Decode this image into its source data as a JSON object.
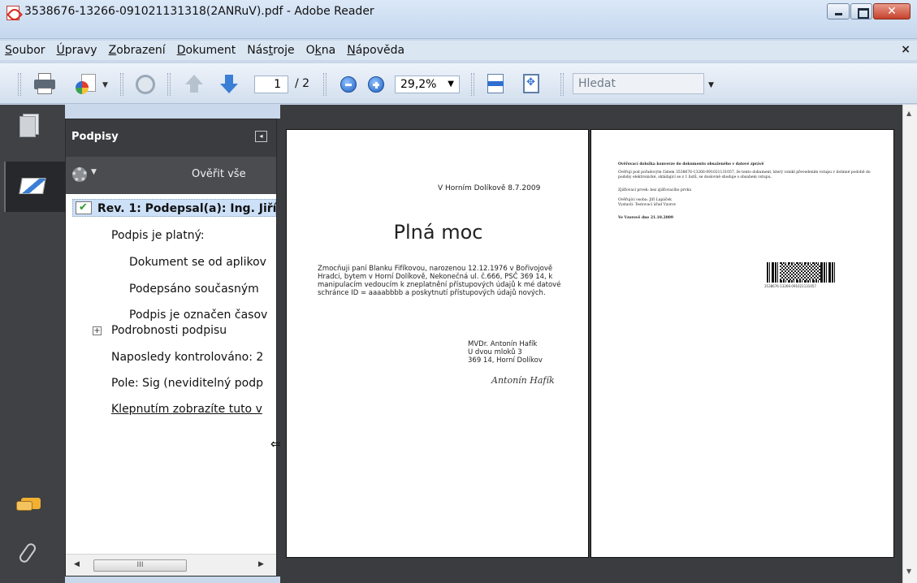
{
  "window": {
    "title": "3538676-13266-091021131318(2ANRuV).pdf - Adobe Reader"
  },
  "menu": [
    {
      "pre": "",
      "ul": "S",
      "post": "oubor"
    },
    {
      "pre": "",
      "ul": "Ú",
      "post": "pravy"
    },
    {
      "pre": "",
      "ul": "Z",
      "post": "obrazení"
    },
    {
      "pre": "",
      "ul": "D",
      "post": "okument"
    },
    {
      "pre": "Nás",
      "ul": "t",
      "post": "roje"
    },
    {
      "pre": "O",
      "ul": "k",
      "post": "na"
    },
    {
      "pre": "",
      "ul": "N",
      "post": "ápověda"
    }
  ],
  "menu_close": "×",
  "toolbar": {
    "page_current": "1",
    "page_total": "/ 2",
    "zoom": "29,2%",
    "search_placeholder": "Hledat"
  },
  "panel": {
    "title": "Podpisy",
    "collapse_glyph": "◂",
    "verify_all": "Ověřit vše",
    "rows": [
      "Rev. 1: Podepsal(a): Ing. Jiří",
      "Podpis je platný:",
      "Dokument se od aplikov",
      "Podepsáno současným",
      "Podpis je označen časov",
      "Podrobnosti podpisu",
      "Naposledy kontrolováno: 2",
      "Pole: Sig (neviditelný podp",
      "Klepnutím zobrazíte tuto v"
    ],
    "expander": "+",
    "hscroll_thumb": "III"
  },
  "page1": {
    "date": "V Horním Dolíkově 8.7.2009",
    "heading": "Plná moc",
    "body": "Zmocňuji paní Blanku Fifíkovou, narozenou 12.12.1976 v Bořivojově Hradci, bytem v Horní Dolíkově, Nekonečná ul. č.666, PSČ 369 14, k manipulacím vedoucím k zneplatnění přístupových údajů k mé datové schránce ID = aaaabbbb a poskytnutí přístupových údajů nových.",
    "addr_name": "MVDr. Antonín Hafík",
    "addr_street": "U dvou mloků 3",
    "addr_city": "369 14, Horní Dolíkov",
    "signature": "Antonín Hafík"
  },
  "page2": {
    "heading": "Ověřovací doložka konverze do dokumentu obsaženého v datové zprávě",
    "para": "Ověřuji pod pořadovým číslem 3538676-13266-091021131057, že tento dokument, který vznikl převedením vstupu v listinné podobě do podoby elektronické, skládající se z 1 listů, se doslovně shoduje s obsahem vstupu.",
    "security": "Zjišťovací prvek: bez zjišťovacího prvku",
    "verifier": "Ověřující osoba: Jiří Lapáček",
    "issuer": "Vystavil: Testovací úřad Vzorov",
    "place_date": "Ve Vzorově dne 21.10.2009",
    "barcode_text": "3538676-13266-091021131057"
  }
}
